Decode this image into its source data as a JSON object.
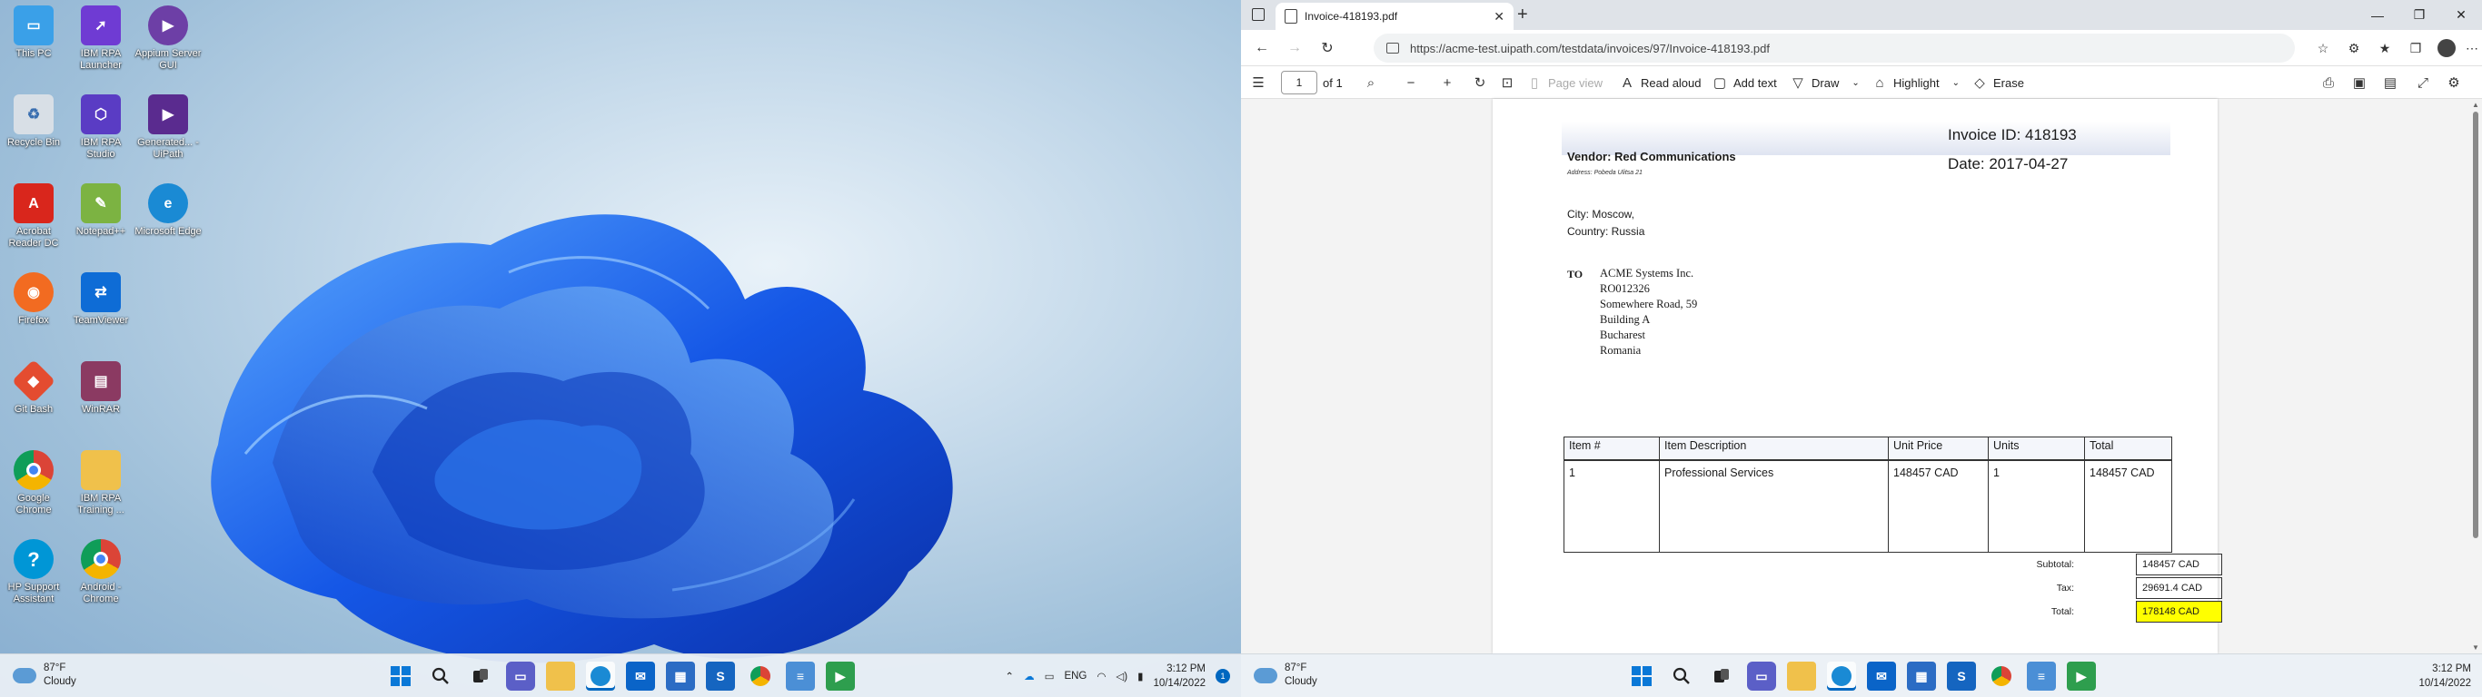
{
  "desktop": {
    "icons": [
      {
        "label": "This PC",
        "icon": "monitor-icon",
        "color": "#3aa0e8"
      },
      {
        "label": "IBM RPA Launcher",
        "icon": "rocket-icon",
        "color": "#6f3bd3"
      },
      {
        "label": "Appium Server GUI",
        "icon": "appium-icon",
        "color": "#6d3fa6"
      },
      {
        "label": "Recycle Bin",
        "icon": "recycle-bin-icon",
        "color": "#d8dfe6"
      },
      {
        "label": "IBM RPA Studio",
        "icon": "ibm-studio-icon",
        "color": "#5a3cc4"
      },
      {
        "label": "Generated... - UiPath",
        "icon": "uipath-icon",
        "color": "#5a2b8f"
      },
      {
        "label": "Acrobat Reader DC",
        "icon": "acrobat-icon",
        "color": "#d9261c"
      },
      {
        "label": "Notepad++",
        "icon": "notepad-plus-icon",
        "color": "#7cb342"
      },
      {
        "label": "Microsoft Edge",
        "icon": "edge-icon",
        "color": "#1a8ad4"
      },
      {
        "label": "Firefox",
        "icon": "firefox-icon",
        "color": "#f26b21"
      },
      {
        "label": "TeamViewer",
        "icon": "teamviewer-icon",
        "color": "#0e6cd6"
      },
      {
        "label": "Git Bash",
        "icon": "git-bash-icon",
        "color": "#e44c30"
      },
      {
        "label": "WinRAR",
        "icon": "winrar-icon",
        "color": "#8b3a62"
      },
      {
        "label": "Google Chrome",
        "icon": "chrome-icon",
        "color": "#db4437"
      },
      {
        "label": "IBM RPA Training ...",
        "icon": "folder-icon",
        "color": "#f0c14b"
      },
      {
        "label": "HP Support Assistant",
        "icon": "help-icon",
        "color": "#0096d6"
      },
      {
        "label": "Android - Chrome",
        "icon": "chrome-icon",
        "color": "#34a853"
      }
    ]
  },
  "taskbar": {
    "weather_temp": "87°F",
    "weather_desc": "Cloudy",
    "apps": [
      {
        "name": "windows-start-icon",
        "color": "#0a78d7"
      },
      {
        "name": "search-icon",
        "color": "#333333"
      },
      {
        "name": "task-view-icon",
        "color": "#333333"
      },
      {
        "name": "teams-chat-icon",
        "color": "#5b5fc7"
      },
      {
        "name": "file-explorer-icon",
        "color": "#f0c14b"
      },
      {
        "name": "edge-icon",
        "color": "#1a8ad4"
      },
      {
        "name": "mail-icon",
        "color": "#0a64c8"
      },
      {
        "name": "store-icon",
        "color": "#2b6cc4"
      },
      {
        "name": "sap-icon",
        "color": "#1565c0"
      },
      {
        "name": "chrome-icon",
        "color": "#db4437"
      },
      {
        "name": "notepad-icon",
        "color": "#4b8fd6"
      },
      {
        "name": "uipath-assistant-icon",
        "color": "#2e9e4e"
      }
    ],
    "lang": "ENG",
    "time": "3:12 PM",
    "date": "10/14/2022",
    "notifications": "1"
  },
  "browser": {
    "tab_title": "Invoice-418193.pdf",
    "url": "https://acme-test.uipath.com/testdata/invoices/97/Invoice-418193.pdf",
    "toolbar": {
      "page_number": "1",
      "page_count": "of 1",
      "page_view": "Page view",
      "read_aloud": "Read aloud",
      "add_text": "Add text",
      "draw": "Draw",
      "highlight": "Highlight",
      "erase": "Erase"
    }
  },
  "invoice": {
    "invoice_id": "Invoice ID: 418193",
    "date": "Date: 2017-04-27",
    "vendor": "Vendor: Red Communications",
    "address": "Address: Pobeda Ulitsa 21",
    "city": "City: Moscow,",
    "country": "Country: Russia",
    "to_label": "TO",
    "to_lines": [
      "ACME Systems Inc.",
      "RO012326",
      "Somewhere Road, 59",
      "Building A",
      "Bucharest",
      "Romania"
    ],
    "table": {
      "headers": [
        "Item #",
        "Item Description",
        "Unit Price",
        "Units",
        "Total"
      ],
      "rows": [
        [
          "1",
          "Professional Services",
          "148457 CAD",
          "1",
          "148457 CAD"
        ]
      ]
    },
    "subtotal_label": "Subtotal:",
    "subtotal": "148457 CAD",
    "tax_label": "Tax:",
    "tax": "29691.4 CAD",
    "total_label": "Total:",
    "total": "178148 CAD"
  }
}
